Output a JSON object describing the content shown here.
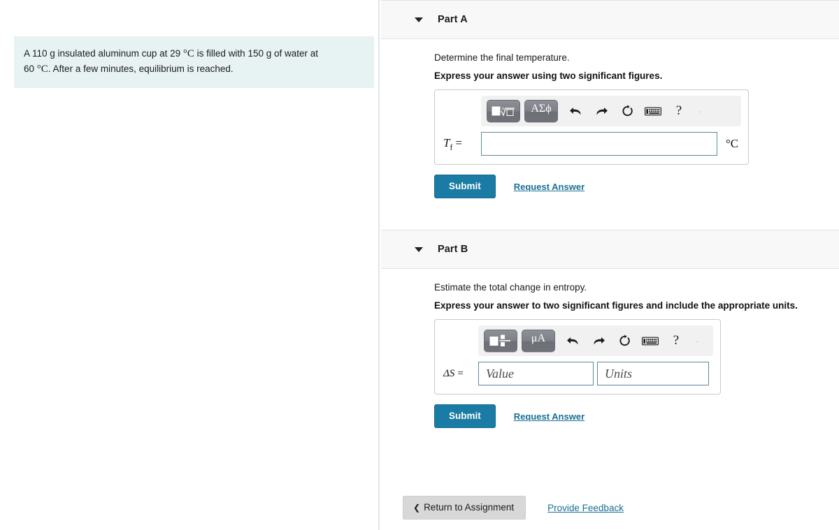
{
  "problem": {
    "text_line1": "A 110 g insulated aluminum cup at 29 ",
    "unit1": "°C",
    "text_line1b": " is filled with 150 g of water at",
    "text_line2": "60 ",
    "unit2": "°C",
    "text_line2b": ". After a few minutes, equilibrium is reached."
  },
  "parts": [
    {
      "title": "Part A",
      "prompt": "Determine the final temperature.",
      "instruction": "Express your answer using two significant figures.",
      "toolbar": {
        "template_button": "template-icon",
        "greek_button": "ΑΣϕ",
        "undo": "undo-icon",
        "redo": "redo-icon",
        "reset": "reset-icon",
        "keyboard": "keyboard-icon",
        "help": "?"
      },
      "label": "T",
      "label_sub": "f",
      "equals": "=",
      "value": "",
      "placeholder": "",
      "unit_suffix": "°C",
      "submit_label": "Submit",
      "request_label": "Request Answer"
    },
    {
      "title": "Part B",
      "prompt": "Estimate the total change in entropy.",
      "instruction": "Express your answer to two significant figures and include the appropriate units.",
      "toolbar": {
        "template_button": "units-template-icon",
        "greek_button": "μA",
        "undo": "undo-icon",
        "redo": "redo-icon",
        "reset": "reset-icon",
        "keyboard": "keyboard-icon",
        "help": "?"
      },
      "label": "ΔS",
      "label_sub": "",
      "equals": "=",
      "value": "",
      "placeholder": "Value",
      "units_value": "",
      "units_placeholder": "Units",
      "submit_label": "Submit",
      "request_label": "Request Answer"
    }
  ],
  "footer": {
    "return_chevron": "❮",
    "return_label": "Return to Assignment",
    "feedback_label": "Provide Feedback"
  },
  "colors": {
    "problem_bg": "#e7f3f2",
    "submit_bg": "#1a7ba4",
    "link": "#1a6f93",
    "band_bg": "#f8f8f8",
    "input_border": "#5c8a96"
  }
}
